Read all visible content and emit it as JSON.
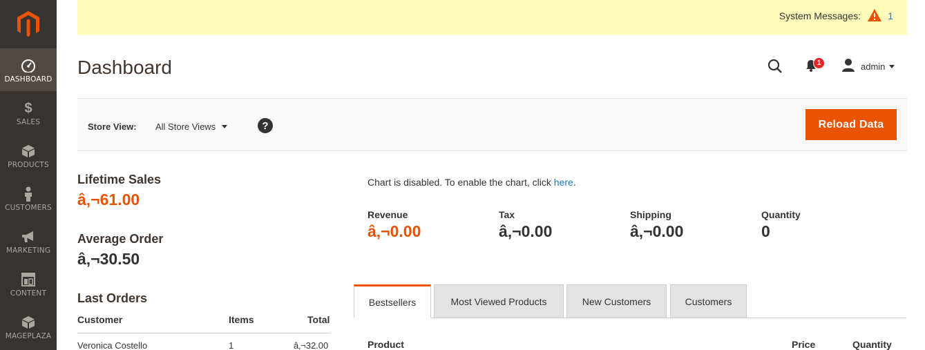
{
  "brand": {
    "logo_icon": "magento-logo-icon",
    "accent": "#eb5202"
  },
  "sidebar": {
    "items": [
      {
        "label": "DASHBOARD",
        "icon": "speedometer-icon",
        "active": true
      },
      {
        "label": "SALES",
        "icon": "dollar-icon"
      },
      {
        "label": "PRODUCTS",
        "icon": "cube-icon"
      },
      {
        "label": "CUSTOMERS",
        "icon": "person-icon"
      },
      {
        "label": "MARKETING",
        "icon": "megaphone-icon"
      },
      {
        "label": "CONTENT",
        "icon": "layout-icon"
      },
      {
        "label": "MAGEPLAZA",
        "icon": "box-icon"
      }
    ]
  },
  "system_messages": {
    "label": "System Messages:",
    "count": "1",
    "icon": "warning-icon"
  },
  "header": {
    "title": "Dashboard",
    "notifications_count": "1",
    "user_name": "admin"
  },
  "store_view": {
    "label": "Store View:",
    "selected": "All Store Views",
    "help": "?",
    "reload_label": "Reload Data"
  },
  "totals_left": {
    "lifetime_sales_label": "Lifetime Sales",
    "lifetime_sales_value": "â‚¬61.00",
    "average_order_label": "Average Order",
    "average_order_value": "â‚¬30.50"
  },
  "last_orders": {
    "title": "Last Orders",
    "columns": [
      "Customer",
      "Items",
      "Total"
    ],
    "rows": [
      {
        "customer": "Veronica Costello",
        "items": "1",
        "total": "â‚¬32.00"
      }
    ]
  },
  "chart": {
    "message_prefix": "Chart is disabled. To enable the chart, click ",
    "link_text": "here",
    "message_suffix": "."
  },
  "totals": [
    {
      "label": "Revenue",
      "value": "â‚¬0.00"
    },
    {
      "label": "Tax",
      "value": "â‚¬0.00"
    },
    {
      "label": "Shipping",
      "value": "â‚¬0.00"
    },
    {
      "label": "Quantity",
      "value": "0"
    }
  ],
  "tabs": [
    {
      "label": "Bestsellers",
      "active": true
    },
    {
      "label": "Most Viewed Products"
    },
    {
      "label": "New Customers"
    },
    {
      "label": "Customers"
    }
  ],
  "grid": {
    "columns": [
      "Product",
      "Price",
      "Quantity"
    ]
  }
}
